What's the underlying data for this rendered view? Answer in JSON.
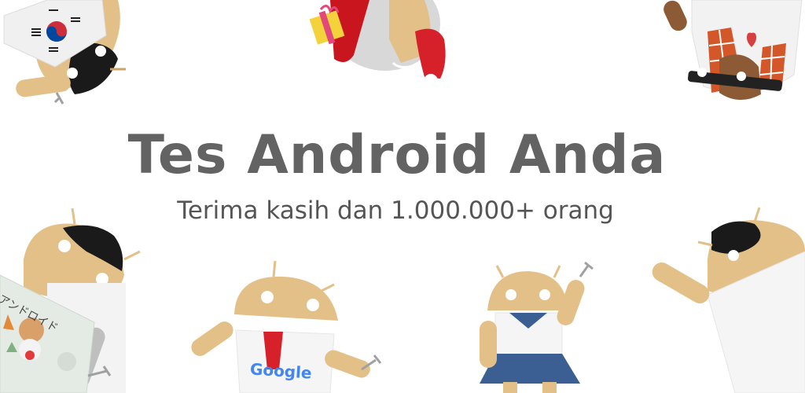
{
  "banner": {
    "title": "Tes Android Anda",
    "subtitle": "Terima kasih dan 1.000.000+ orang",
    "google_logo_text": "Google",
    "japanese_sign_text": "アンドロイド"
  },
  "colors": {
    "android_skin": "#e3c088",
    "android_skin_dark": "#caa46b",
    "hair": "#1a1a1a",
    "title_text": "#636363",
    "subtitle_text": "#555555",
    "santa_red": "#d6202a",
    "skirt_blue": "#3b5f92",
    "plaid_orange": "#d4572a",
    "background": "#ffffff"
  },
  "icons": [
    "wrench-icon",
    "korean-flag-icon",
    "gift-icon",
    "heart-icon",
    "google-logo-icon"
  ]
}
